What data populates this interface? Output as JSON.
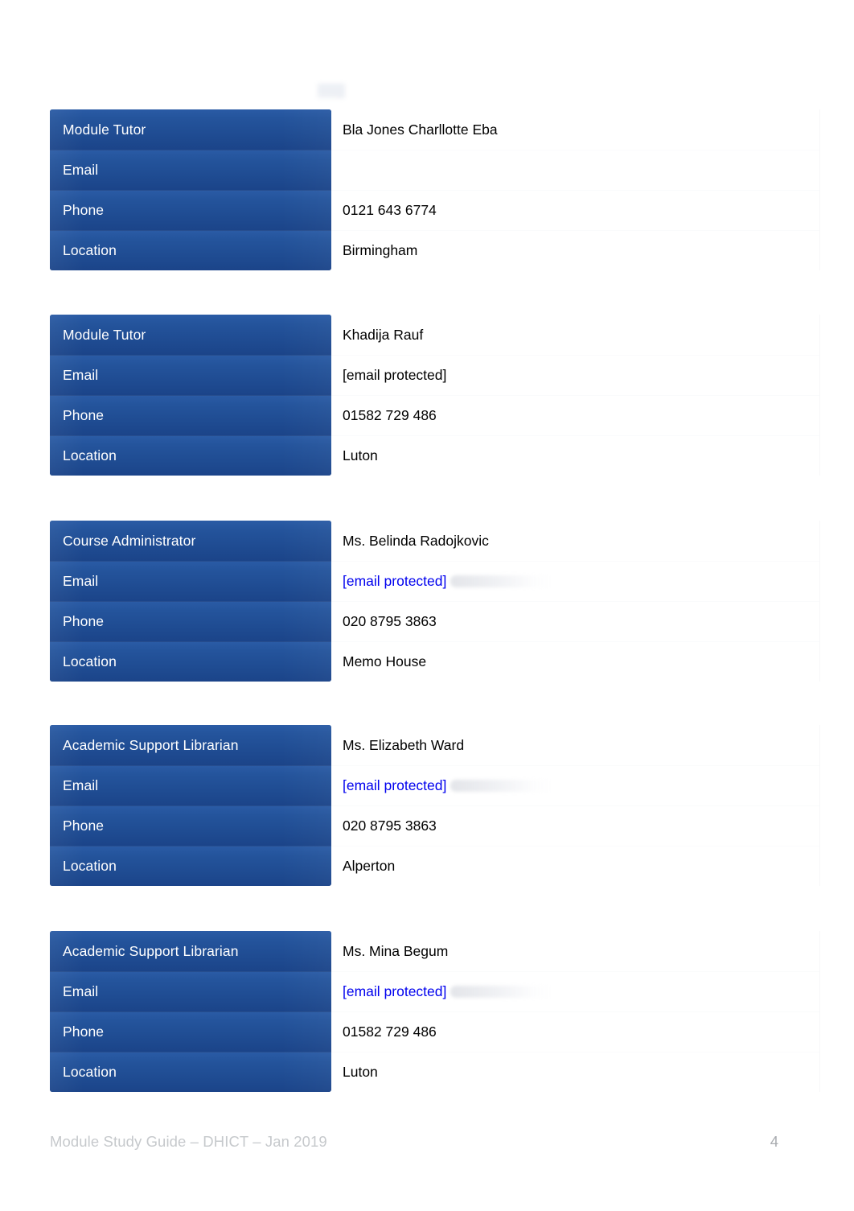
{
  "document": {
    "colors": {
      "label_blue": "#1f4e96",
      "link_blue": "#0000ee",
      "footer_grey": "#c6c9cc",
      "value_text": "#000000"
    },
    "field_labels": {
      "email": "Email",
      "phone": "Phone",
      "location": "Location"
    },
    "email_placeholder": "[email protected]",
    "contacts": [
      {
        "role": "Module Tutor",
        "name": "Bla Jones Charllotte Eba",
        "email": "",
        "email_is_link": false,
        "email_has_redaction": false,
        "phone": "0121 643 6774",
        "location": "Birmingham"
      },
      {
        "role": "Module Tutor",
        "name": "Khadija Rauf",
        "email": "[email protected]",
        "email_is_link": false,
        "email_has_redaction": false,
        "phone": "01582 729 486",
        "location": "Luton"
      },
      {
        "role": "Course Administrator",
        "name": "Ms. Belinda Radojkovic",
        "email": "[email protected]",
        "email_is_link": true,
        "email_has_redaction": true,
        "phone": "020 8795 3863",
        "location": "Memo House"
      },
      {
        "role": "Academic Support Librarian",
        "name": "Ms. Elizabeth Ward",
        "email": "[email protected]",
        "email_is_link": true,
        "email_has_redaction": true,
        "phone": "020 8795 3863",
        "location": "Alperton"
      },
      {
        "role": "Academic Support Librarian",
        "name": "Ms. Mina Begum",
        "email": "[email protected]",
        "email_is_link": true,
        "email_has_redaction": true,
        "phone": "01582 729 486",
        "location": "Luton"
      }
    ],
    "footer": {
      "text": "Module Study Guide – DHICT – Jan 2019",
      "page_number": "4"
    }
  }
}
